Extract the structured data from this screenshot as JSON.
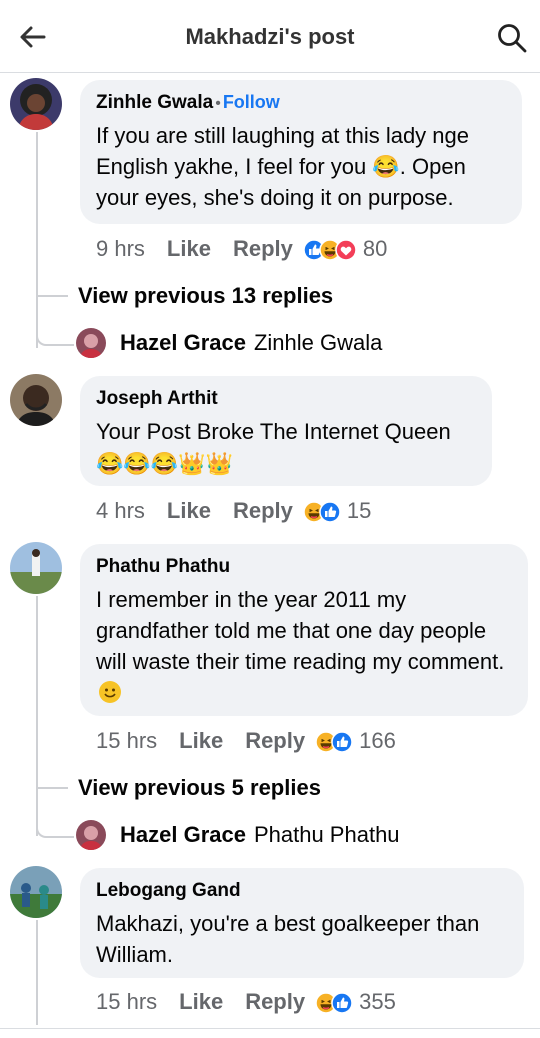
{
  "header": {
    "title": "Makhadzi's post"
  },
  "comments": [
    {
      "author": "Zinhle Gwala",
      "follow_label": "Follow",
      "separator": "•",
      "text": "If you are still laughing at this lady nge English yakhe, I feel for you 😂. Open your eyes, she's doing it on purpose.",
      "time": "9 hrs",
      "like": "Like",
      "reply": "Reply",
      "count": "80",
      "reactions": [
        "like",
        "haha",
        "love"
      ],
      "view_previous": "View previous 13 replies",
      "latest_reply": {
        "author": "Hazel Grace",
        "text": "Zinhle Gwala"
      }
    },
    {
      "author": "Joseph Arthit",
      "text": "Your Post Broke The Internet Queen",
      "emoji_line": [
        "😂",
        "😂",
        "😂",
        "👑",
        "👑"
      ],
      "time": "4 hrs",
      "like": "Like",
      "reply": "Reply",
      "count": "15",
      "reactions": [
        "haha",
        "like"
      ]
    },
    {
      "author": "Phathu Phathu",
      "text": "I remember in the year 2011 my grandfather told me that one day people will waste their time reading my comment.",
      "time": "15 hrs",
      "like": "Like",
      "reply": "Reply",
      "count": "166",
      "reactions": [
        "haha",
        "like"
      ],
      "view_previous": "View previous 5 replies",
      "latest_reply": {
        "author": "Hazel Grace",
        "text": "Phathu Phathu"
      }
    },
    {
      "author": "Lebogang Gand",
      "text": "Makhazi, you're a best goalkeeper than William.",
      "time": "15 hrs",
      "like": "Like",
      "reply": "Reply",
      "count": "355",
      "reactions": [
        "haha",
        "like"
      ]
    }
  ],
  "colors": {
    "link": "#1877f2",
    "bubble": "#f0f2f5",
    "meta": "#65676b",
    "like": "#1877f2",
    "love": "#f33e58",
    "haha": "#f7b125"
  }
}
